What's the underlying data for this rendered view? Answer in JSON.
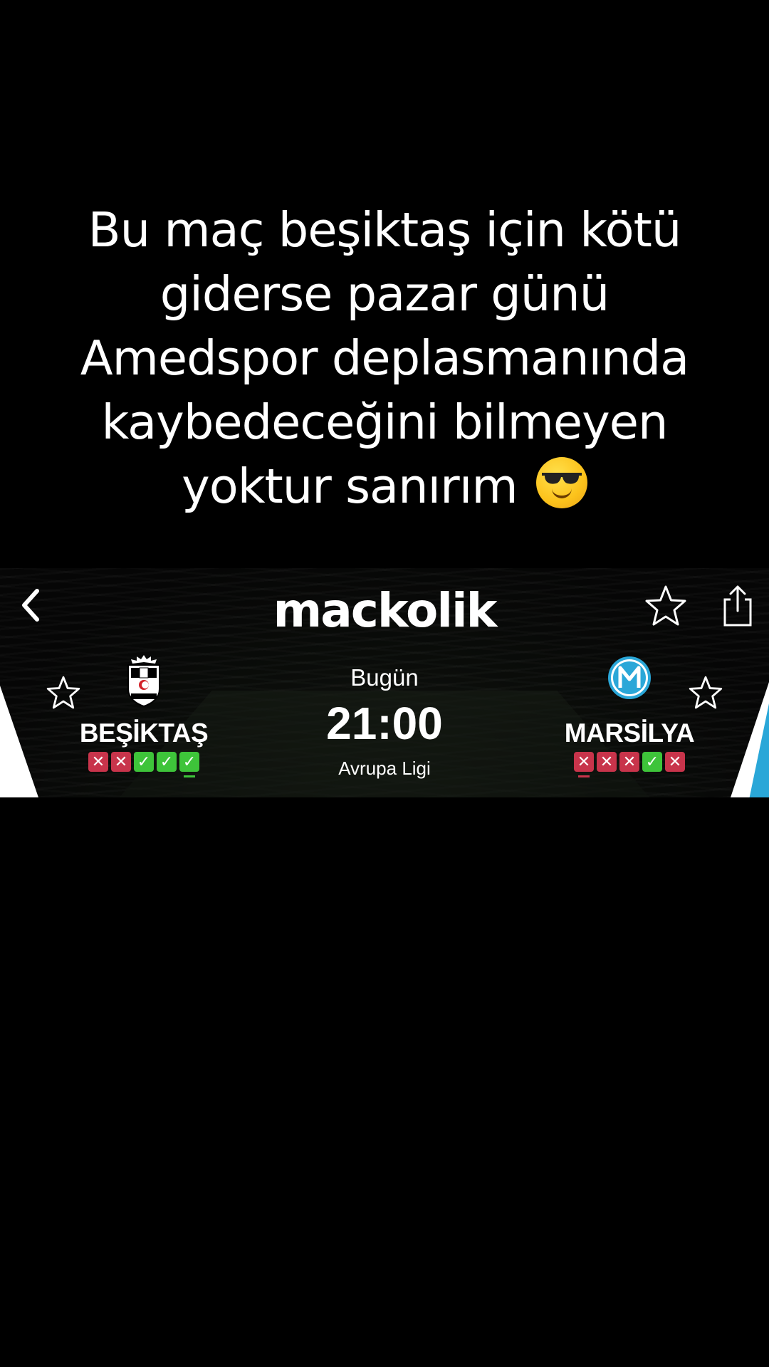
{
  "caption": {
    "lines": [
      "Bu maç beşiktaş için kötü",
      "giderse pazar günü",
      "Amedspor deplasmanında",
      "kaybedeceğini bilmeyen",
      "yoktur sanırım"
    ],
    "emoji": "smiling-face-with-sunglasses"
  },
  "header": {
    "logo_text": "mackolik",
    "back_icon": "chevron-left-icon",
    "favorite_icon": "star-outline-icon",
    "share_icon": "share-icon"
  },
  "match": {
    "day": "Bugün",
    "time": "21:00",
    "competition": "Avrupa Ligi",
    "home": {
      "name": "BEŞİKTAŞ",
      "crest_icon": "besiktas-crest-icon",
      "form": [
        "L",
        "L",
        "W",
        "W",
        "W"
      ],
      "form_latest_index": 4
    },
    "away": {
      "name": "MARSİLYA",
      "crest_icon": "marseille-crest-icon",
      "form": [
        "L",
        "L",
        "L",
        "W",
        "L"
      ],
      "form_latest_index": 0
    }
  },
  "colors": {
    "background": "#000000",
    "loss": "#c8344b",
    "win": "#3ec43a",
    "marseille_blue": "#2aa7d8",
    "text": "#ffffff"
  }
}
